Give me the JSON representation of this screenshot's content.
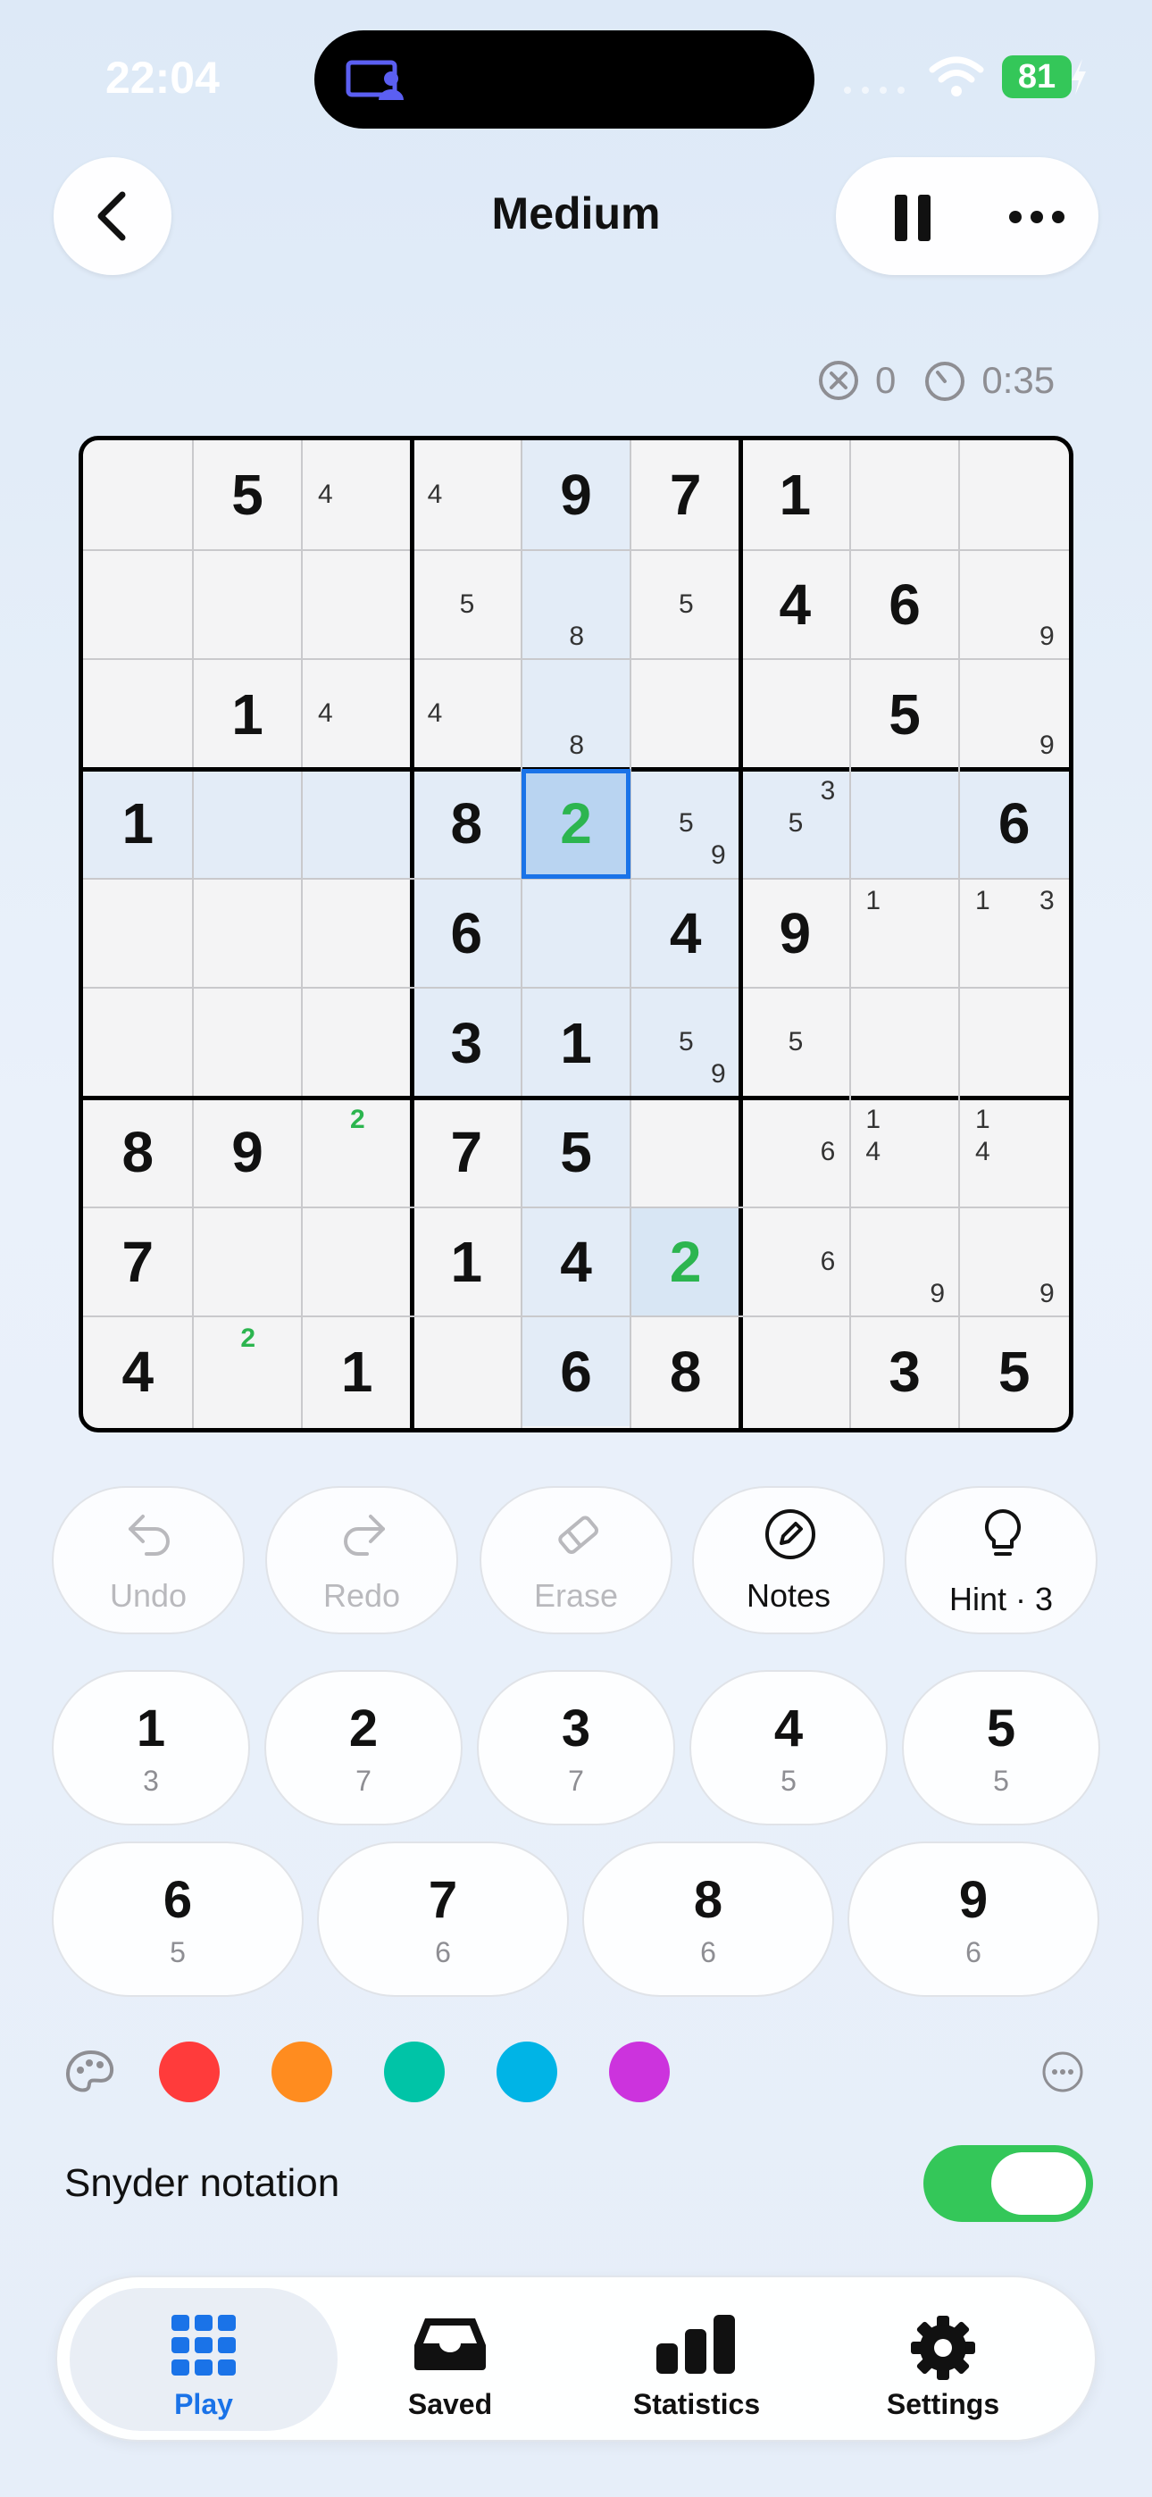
{
  "status": {
    "time": "22:04",
    "battery": "81"
  },
  "header": {
    "title": "Medium"
  },
  "stats": {
    "mistakes": "0",
    "timer": "0:35"
  },
  "grid": {
    "values": [
      [
        "",
        "5",
        "",
        "",
        "9",
        "7",
        "1",
        "",
        ""
      ],
      [
        "",
        "",
        "",
        "",
        "",
        "",
        "4",
        "6",
        ""
      ],
      [
        "",
        "1",
        "",
        "",
        "",
        "",
        "",
        "5",
        ""
      ],
      [
        "1",
        "",
        "",
        "8",
        "2",
        "",
        "",
        "",
        "6"
      ],
      [
        "",
        "",
        "",
        "6",
        "",
        "4",
        "9",
        "",
        ""
      ],
      [
        "",
        "",
        "",
        "3",
        "1",
        "",
        "",
        "",
        ""
      ],
      [
        "8",
        "9",
        "",
        "7",
        "5",
        "",
        "",
        "",
        ""
      ],
      [
        "7",
        "",
        "",
        "1",
        "4",
        "2",
        "",
        "",
        ""
      ],
      [
        "4",
        "",
        "1",
        "",
        "6",
        "8",
        "",
        "3",
        "5"
      ]
    ],
    "green_cells": [
      [
        3,
        4
      ],
      [
        7,
        5
      ]
    ],
    "selected": [
      3,
      4
    ],
    "notes": [
      {
        "r": 0,
        "c": 2,
        "n": "4"
      },
      {
        "r": 0,
        "c": 3,
        "n": "4"
      },
      {
        "r": 1,
        "c": 3,
        "n": "5"
      },
      {
        "r": 1,
        "c": 4,
        "n": "8"
      },
      {
        "r": 1,
        "c": 5,
        "n": "5"
      },
      {
        "r": 1,
        "c": 8,
        "n": "9"
      },
      {
        "r": 2,
        "c": 2,
        "n": "4"
      },
      {
        "r": 2,
        "c": 3,
        "n": "4"
      },
      {
        "r": 2,
        "c": 4,
        "n": "8"
      },
      {
        "r": 2,
        "c": 8,
        "n": "9"
      },
      {
        "r": 3,
        "c": 5,
        "n": "5"
      },
      {
        "r": 3,
        "c": 5,
        "n": "9"
      },
      {
        "r": 3,
        "c": 6,
        "n": "3"
      },
      {
        "r": 3,
        "c": 6,
        "n": "5"
      },
      {
        "r": 4,
        "c": 7,
        "n": "1"
      },
      {
        "r": 4,
        "c": 8,
        "n": "1"
      },
      {
        "r": 4,
        "c": 8,
        "n": "3"
      },
      {
        "r": 5,
        "c": 5,
        "n": "5"
      },
      {
        "r": 5,
        "c": 5,
        "n": "9"
      },
      {
        "r": 5,
        "c": 6,
        "n": "5"
      },
      {
        "r": 6,
        "c": 2,
        "n": "2",
        "green": true
      },
      {
        "r": 6,
        "c": 6,
        "n": "6"
      },
      {
        "r": 6,
        "c": 7,
        "n": "1"
      },
      {
        "r": 6,
        "c": 7,
        "n": "4"
      },
      {
        "r": 6,
        "c": 8,
        "n": "1"
      },
      {
        "r": 6,
        "c": 8,
        "n": "4"
      },
      {
        "r": 7,
        "c": 6,
        "n": "6"
      },
      {
        "r": 7,
        "c": 7,
        "n": "9"
      },
      {
        "r": 7,
        "c": 8,
        "n": "9"
      },
      {
        "r": 8,
        "c": 1,
        "n": "2",
        "green": true
      }
    ]
  },
  "tools": {
    "undo": "Undo",
    "redo": "Redo",
    "erase": "Erase",
    "notes": "Notes",
    "hint": "Hint · 3"
  },
  "numpad": [
    {
      "num": "1",
      "count": "3"
    },
    {
      "num": "2",
      "count": "7"
    },
    {
      "num": "3",
      "count": "7"
    },
    {
      "num": "4",
      "count": "5"
    },
    {
      "num": "5",
      "count": "5"
    },
    {
      "num": "6",
      "count": "5"
    },
    {
      "num": "7",
      "count": "6"
    },
    {
      "num": "8",
      "count": "6"
    },
    {
      "num": "9",
      "count": "6"
    }
  ],
  "colors": [
    "#ff3b3b",
    "#ff8c1f",
    "#00c4a7",
    "#00b4e6",
    "#cc33dd"
  ],
  "settings": {
    "snyder_label": "Snyder notation"
  },
  "tabs": [
    {
      "label": "Play",
      "icon": "grid-icon"
    },
    {
      "label": "Saved",
      "icon": "tray-icon"
    },
    {
      "label": "Statistics",
      "icon": "bar-chart-icon"
    },
    {
      "label": "Settings",
      "icon": "gear-icon"
    }
  ]
}
